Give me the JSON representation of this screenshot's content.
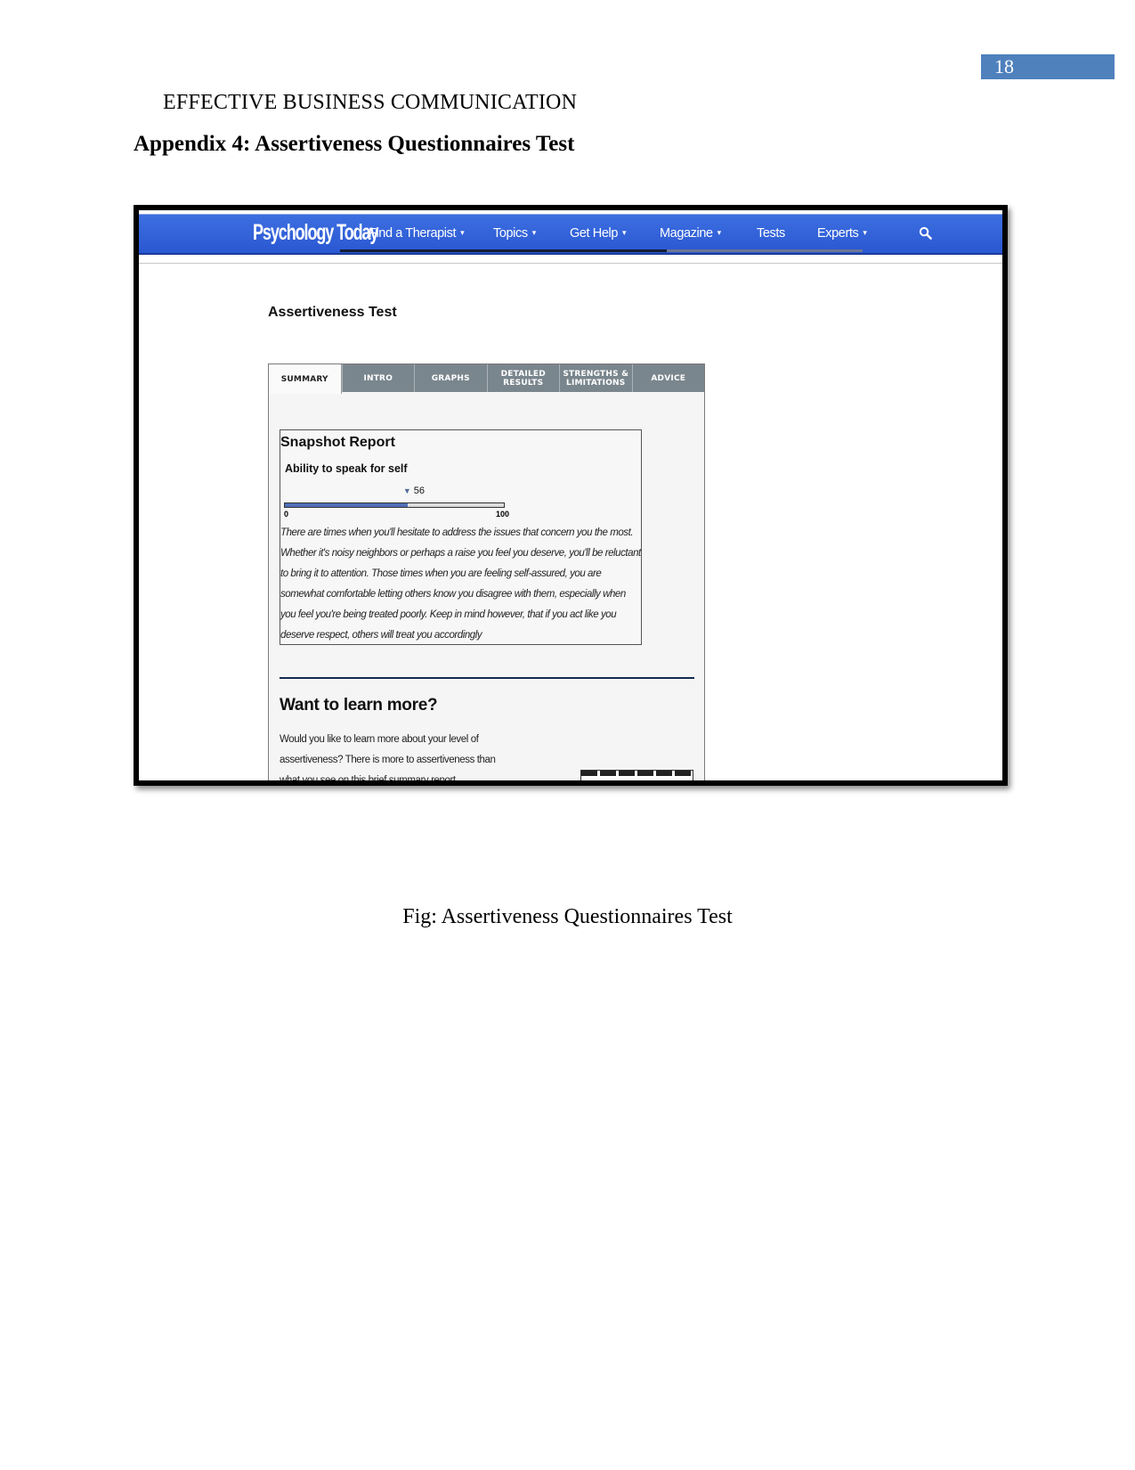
{
  "document": {
    "page_number": "18",
    "running_header": "EFFECTIVE BUSINESS COMMUNICATION",
    "appendix_title": "Appendix 4: Assertiveness Questionnaires Test",
    "figure_caption": "Fig: Assertiveness Questionnaires Test",
    "accent_color": "#4f81bd"
  },
  "screenshot": {
    "site": {
      "logo": "Psychology Today",
      "nav_items": [
        {
          "label": "Find a Therapist",
          "has_dropdown": true
        },
        {
          "label": "Topics",
          "has_dropdown": true
        },
        {
          "label": "Get Help",
          "has_dropdown": true
        },
        {
          "label": "Magazine",
          "has_dropdown": true
        },
        {
          "label": "Tests",
          "has_dropdown": false
        },
        {
          "label": "Experts",
          "has_dropdown": true
        }
      ],
      "caret": "▾",
      "search_icon": "search-icon",
      "nav_color": "#2f5fd8"
    },
    "test_title": "Assertiveness Test",
    "tabs": [
      {
        "label": "SUMMARY",
        "active": true
      },
      {
        "label": "INTRO",
        "active": false
      },
      {
        "label": "GRAPHS",
        "active": false
      },
      {
        "label": "DETAILED RESULTS",
        "active": false
      },
      {
        "label": "STRENGTHS & LIMITATIONS",
        "active": false
      },
      {
        "label": "ADVICE",
        "active": false
      }
    ],
    "snapshot": {
      "title": "Snapshot Report",
      "trait": "Ability to speak for self",
      "score": 56,
      "score_display": "56",
      "scale_min": "0",
      "scale_max": "100",
      "description": "There are times when you'll hesitate to address the issues that concern you the most. Whether it's noisy neighbors or perhaps a raise you feel you deserve, you'll be reluctant to bring it to attention. Those times when you are feeling self-assured, you are somewhat comfortable letting others know you disagree with them, especially when you feel you're being treated poorly. Keep in mind however, that if you act like you deserve respect, others will treat you accordingly"
    },
    "learn_more": {
      "heading": "Want to learn more?",
      "text": "Would you like to learn more about your level of assertiveness? There is more to assertiveness than what you see on this brief summary report"
    }
  }
}
